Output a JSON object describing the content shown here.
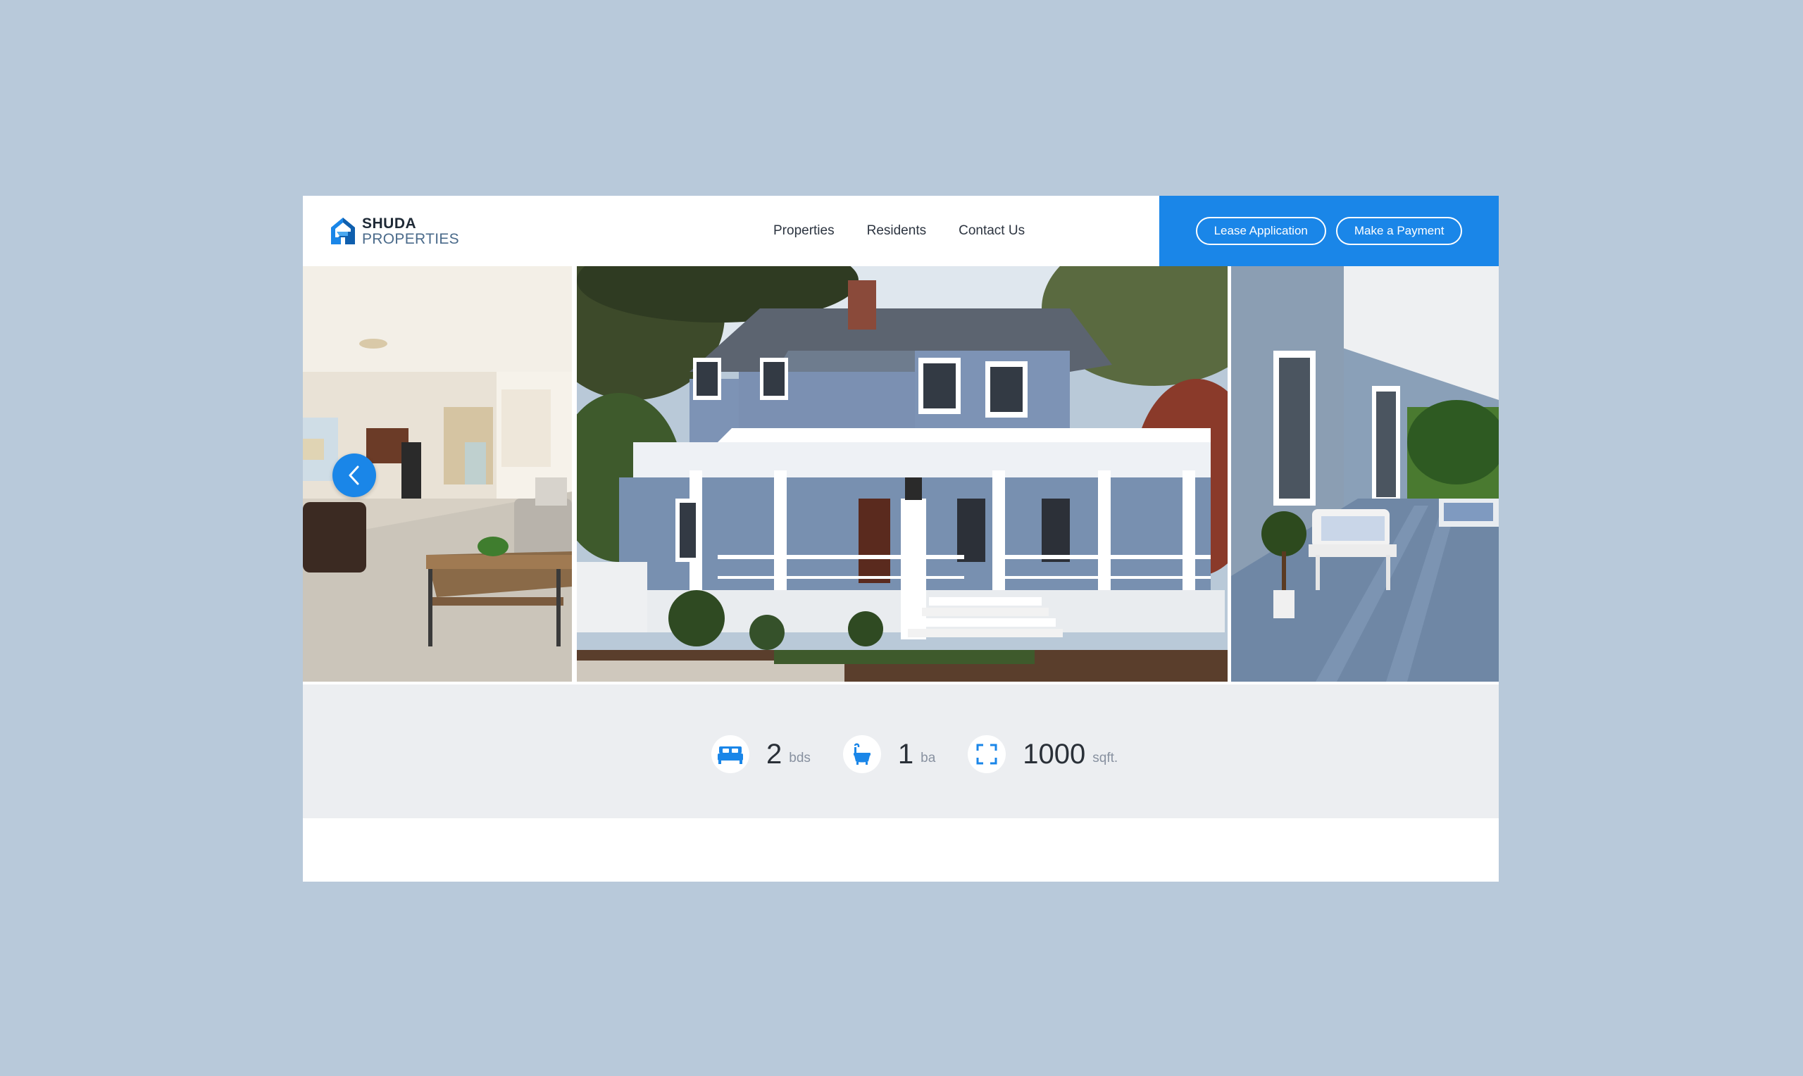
{
  "brand": {
    "line1": "SHUDA",
    "line2": "PROPERTIES",
    "accent_color": "#1a86e8"
  },
  "nav": {
    "items": [
      {
        "label": "Properties"
      },
      {
        "label": "Residents"
      },
      {
        "label": "Contact Us"
      }
    ]
  },
  "cta": {
    "lease_label": "Lease Application",
    "payment_label": "Make a Payment"
  },
  "gallery": {
    "photos": [
      {
        "subject": "living room interior"
      },
      {
        "subject": "blue two-story house with white porch"
      },
      {
        "subject": "porch with wicker bench"
      }
    ],
    "prev_icon": "chevron-left-icon"
  },
  "stats": {
    "beds": {
      "value": "2",
      "unit": "bds",
      "icon": "bed-icon"
    },
    "baths": {
      "value": "1",
      "unit": "ba",
      "icon": "bathtub-icon"
    },
    "area": {
      "value": "1000",
      "unit": "sqft.",
      "icon": "expand-icon"
    }
  }
}
